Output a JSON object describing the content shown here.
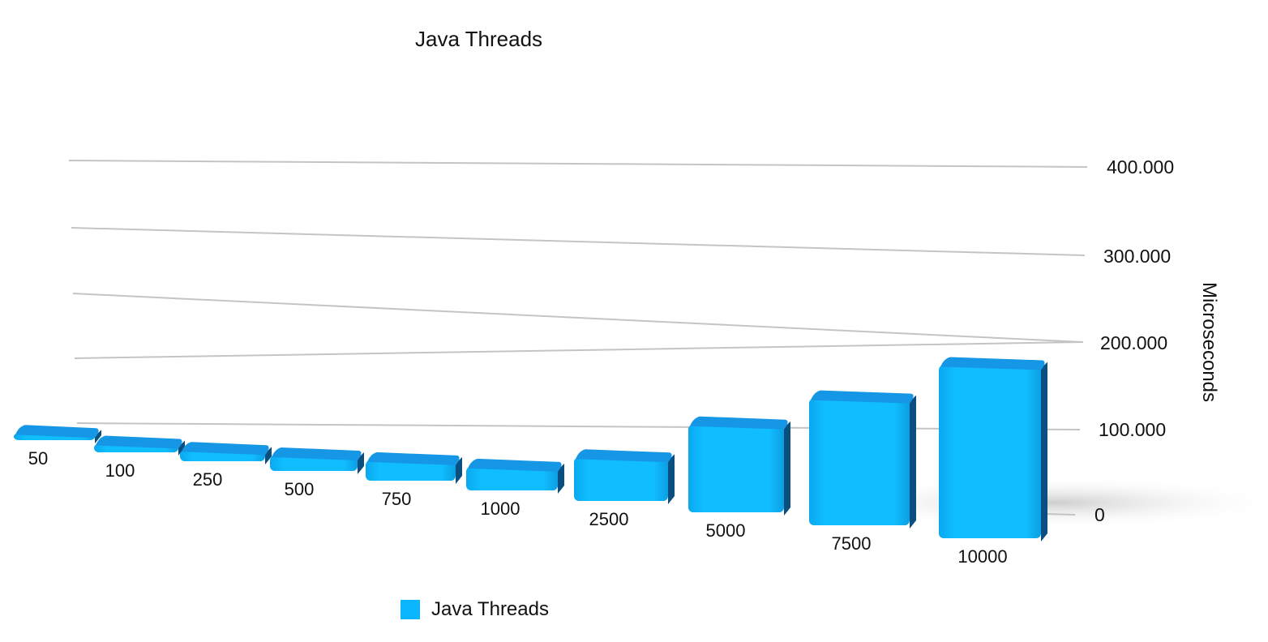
{
  "chart_data": {
    "type": "bar",
    "title": "Java Threads",
    "xlabel": "",
    "ylabel": "Microseconds",
    "categories": [
      "50",
      "100",
      "250",
      "500",
      "750",
      "1000",
      "2500",
      "5000",
      "7500",
      "10000"
    ],
    "series": [
      {
        "name": "Java Threads",
        "values": [
          1000,
          3500,
          8000,
          15000,
          23000,
          28000,
          60000,
          130000,
          190000,
          260000
        ]
      }
    ],
    "y_tick_labels": [
      "0",
      "100.000",
      "200.000",
      "300.000",
      "400.000"
    ],
    "ylim": [
      0,
      400000
    ],
    "grid": true,
    "legend_position": "bottom",
    "colors": {
      "bar_front": "#0bb6fc",
      "bar_top": "#1597e6",
      "bar_side": "#0a4f80",
      "grid": "#c4c4c4"
    }
  }
}
